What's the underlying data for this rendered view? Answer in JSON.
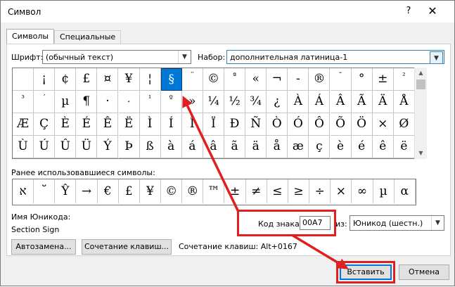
{
  "window": {
    "title": "Символ",
    "help_label": "?",
    "close_label": "✕"
  },
  "tabs": [
    {
      "label": "Символы",
      "active": true
    },
    {
      "label": "Специальные знаки",
      "active": false
    }
  ],
  "font": {
    "label": "Шрифт:",
    "value": "(обычный текст)"
  },
  "subset": {
    "label": "Набор:",
    "value": "дополнительная латиница-1"
  },
  "grid": {
    "rows": [
      [
        " ",
        "¡",
        "¢",
        "£",
        "¤",
        "¥",
        "¦",
        "§",
        "¨",
        "©",
        "ª",
        "«",
        "¬",
        "-",
        "®",
        "¯",
        "°",
        "±",
        "²"
      ],
      [
        "³",
        "´",
        "µ",
        "¶",
        "·",
        "¸",
        "¹",
        "º",
        "»",
        "¼",
        "½",
        "¾",
        "¿",
        "À",
        "Á",
        "Â",
        "Ã",
        "Ä",
        "Å"
      ],
      [
        "Æ",
        "Ç",
        "È",
        "É",
        "Ê",
        "Ë",
        "Ì",
        "Í",
        "Î",
        "Ï",
        "Ð",
        "Ñ",
        "Ò",
        "Ó",
        "Ô",
        "Õ",
        "Ö",
        "×",
        "Ø"
      ],
      [
        "Ù",
        "Ú",
        "Û",
        "Ü",
        "Ý",
        "Þ",
        "ß",
        "à",
        "á",
        "â",
        "ã",
        "ä",
        "å",
        "æ",
        "ç",
        "è",
        "é",
        "ê",
        "ë"
      ]
    ],
    "selected": {
      "row": 0,
      "col": 7
    }
  },
  "recent": {
    "label": "Ранее использовавшиеся символы:",
    "symbols": [
      "ﬡ",
      "ﬞ",
      "Ŷ",
      "→",
      "€",
      "£",
      "¥",
      "©",
      "®",
      "™",
      "±",
      "≠",
      "≤",
      "≥",
      "÷",
      "×",
      "∞",
      "µ",
      "α"
    ]
  },
  "unicode_name": {
    "label": "Имя Юникода:",
    "value": "Section Sign"
  },
  "code": {
    "label": "Код знака:",
    "value": "00A7",
    "from_label": "из:",
    "from_value": "Юникод (шестн.)"
  },
  "buttons": {
    "autocorrect": "Автозамена...",
    "shortcut_key": "Сочетание клавиш...",
    "insert": "Вставить",
    "cancel": "Отмена"
  },
  "shortcut_info": "Сочетание клавиш: Alt+0167",
  "colors": {
    "accent": "#0078d7",
    "annotation": "#e02020"
  }
}
